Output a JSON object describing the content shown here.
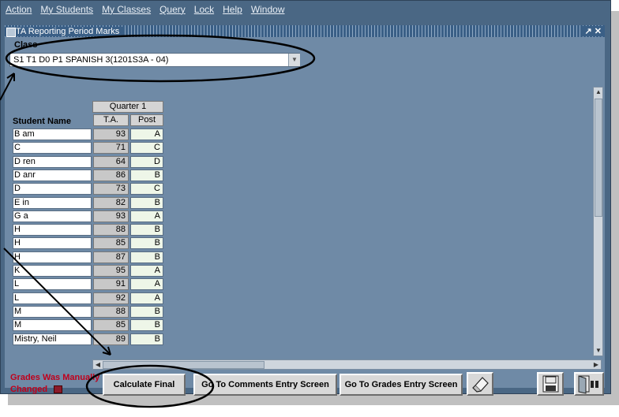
{
  "menu": [
    "Action",
    "My Students",
    "My Classes",
    "Query",
    "Lock",
    "Help",
    "Window"
  ],
  "window": {
    "title": "TA Reporting Period Marks",
    "controls": "↗ ✕"
  },
  "class_section": {
    "label": "Class",
    "value": "S1 T1 D0 P1 SPANISH 3(1201S3A - 04)"
  },
  "grid": {
    "group_header": "Quarter 1",
    "name_header": "Student Name",
    "ta_header": "T.A.",
    "post_header": "Post",
    "rows": [
      {
        "name": "B                 am",
        "ta": "93",
        "post": "A"
      },
      {
        "name": "C",
        "ta": "71",
        "post": "C"
      },
      {
        "name": "D                 ren",
        "ta": "64",
        "post": "D"
      },
      {
        "name": "D                 anr",
        "ta": "86",
        "post": "B"
      },
      {
        "name": "D",
        "ta": "73",
        "post": "C"
      },
      {
        "name": "E                   in",
        "ta": "82",
        "post": "B"
      },
      {
        "name": "G                    a",
        "ta": "93",
        "post": "A"
      },
      {
        "name": "H",
        "ta": "88",
        "post": "B"
      },
      {
        "name": "H",
        "ta": "85",
        "post": "B"
      },
      {
        "name": "H",
        "ta": "87",
        "post": "B"
      },
      {
        "name": "K",
        "ta": "95",
        "post": "A"
      },
      {
        "name": "L",
        "ta": "91",
        "post": "A"
      },
      {
        "name": "L",
        "ta": "92",
        "post": "A"
      },
      {
        "name": "M",
        "ta": "88",
        "post": "B"
      },
      {
        "name": "M",
        "ta": "85",
        "post": "B"
      },
      {
        "name": "Mistry, Neil",
        "ta": "89",
        "post": "B"
      }
    ]
  },
  "status": {
    "line1": "Grades Was Manually",
    "line2": "Changed"
  },
  "buttons": {
    "calculate": "Calculate Final",
    "comments": "Go To Comments Entry Screen",
    "grades": "Go To Grades Entry Screen"
  },
  "icons": {
    "eraser": "eraser-icon",
    "save": "floppy-disk-icon",
    "exit": "door-exit-icon"
  },
  "colors": {
    "background": "#4a6784",
    "panel": "#6f8aa6",
    "warning_text": "#c0001c"
  }
}
